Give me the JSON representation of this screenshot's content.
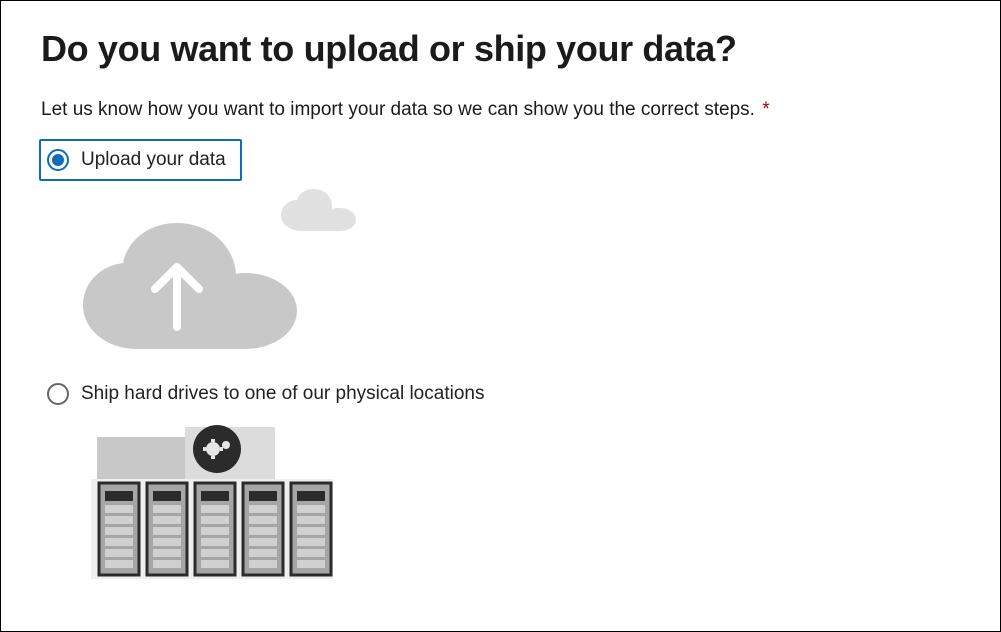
{
  "title": "Do you want to upload or ship your data?",
  "instruction": "Let us know how you want to import your data so we can show you the correct steps.",
  "required_mark": "*",
  "options": {
    "upload": {
      "label": "Upload your data",
      "selected": true,
      "icon": "cloud-upload-icon"
    },
    "ship": {
      "label": "Ship hard drives to one of our physical locations",
      "selected": false,
      "icon": "datacenter-icon"
    }
  },
  "colors": {
    "accent": "#0f6cbd",
    "required": "#a80000",
    "illus_light": "#c8c8c8",
    "illus_mid": "#a6a6a6",
    "illus_dark": "#2b2b2b"
  }
}
